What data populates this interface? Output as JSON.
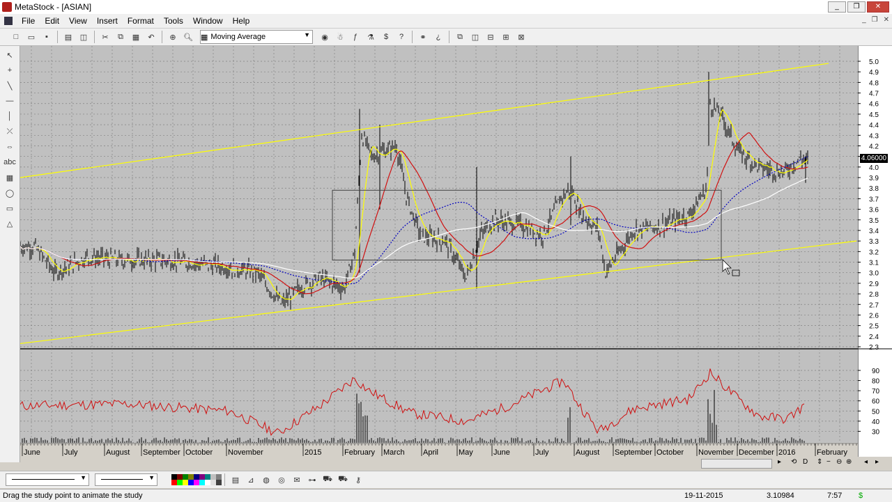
{
  "window": {
    "title": "MetaStock - [ASIAN]"
  },
  "menu": [
    "File",
    "Edit",
    "View",
    "Insert",
    "Format",
    "Tools",
    "Window",
    "Help"
  ],
  "toolbar": {
    "study_select": "Moving Average"
  },
  "chart_data": {
    "type": "line",
    "symbol": "ASIAN",
    "x_labels": [
      "June",
      "July",
      "August",
      "September",
      "October",
      "November",
      "2015",
      "February",
      "March",
      "April",
      "May",
      "June",
      "July",
      "August",
      "September",
      "October",
      "November",
      "December",
      "2016",
      "February"
    ],
    "price_axis": {
      "ticks": [
        "5.0",
        "4.9",
        "4.8",
        "4.7",
        "4.6",
        "4.5",
        "4.4",
        "4.3",
        "4.2",
        "4.1",
        "4.0",
        "3.9",
        "3.8",
        "3.7",
        "3.6",
        "3.5",
        "3.4",
        "3.3",
        "3.2",
        "3.1",
        "3.0",
        "2.9",
        "2.8",
        "2.7",
        "2.6",
        "2.5",
        "2.4",
        "2.3"
      ],
      "range": [
        2.3,
        5.0
      ]
    },
    "last_price": "4.06000",
    "indicator_axis": {
      "ticks": [
        "90",
        "80",
        "70",
        "60",
        "50",
        "40",
        "30"
      ],
      "range": [
        20,
        90
      ]
    },
    "colors": {
      "price": "#000000",
      "ma_short": "#ffff00",
      "ma_mid": "#d01010",
      "ma_long_dotted": "#0000c0",
      "ma_long": "#ffffff",
      "trendline": "#ffff00",
      "indicator": "#d01010",
      "volume": "#000000",
      "background": "#c0c0c0",
      "grid": "#808080"
    }
  },
  "status": {
    "message": "Drag the study point to animate the study",
    "date": "19-11-2015",
    "value": "3.10984",
    "time": "7:57"
  }
}
